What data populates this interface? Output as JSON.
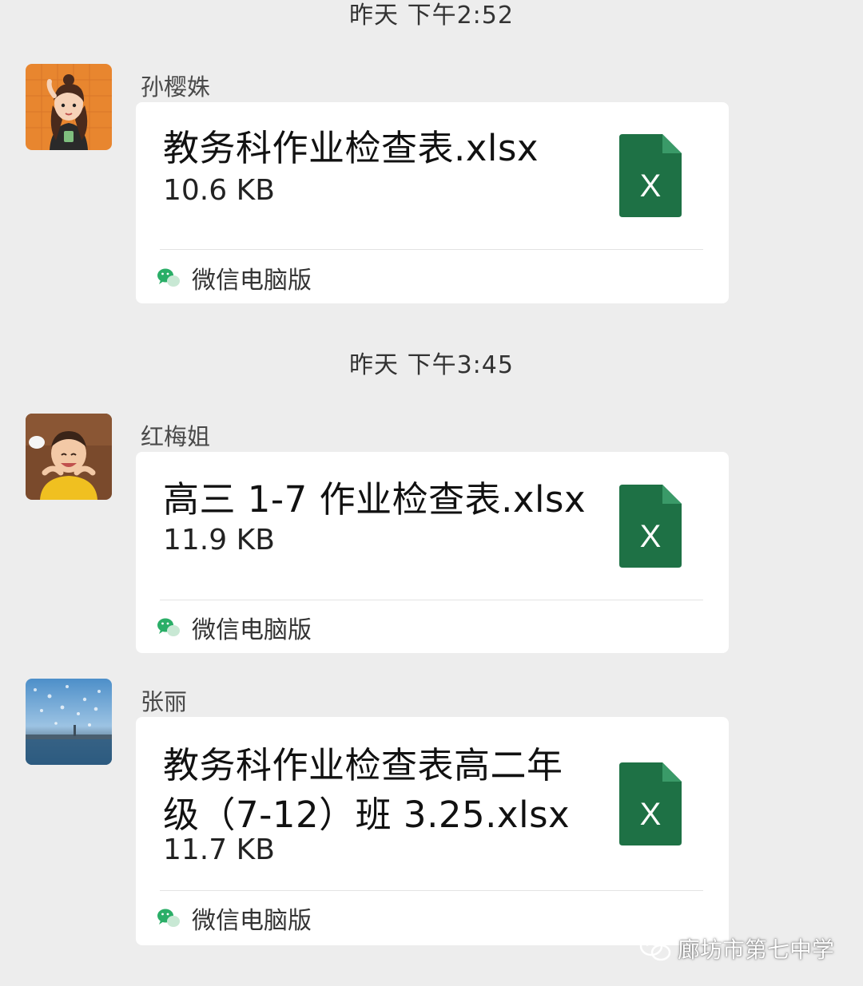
{
  "timestamps": [
    "昨天 下午2:52",
    "昨天 下午3:45"
  ],
  "messages": [
    {
      "sender": "孙樱姝",
      "file_name": "教务科作业检查表.xlsx",
      "file_size": "10.6 KB",
      "file_icon": "excel-file-icon",
      "file_icon_letter": "X",
      "source_icon": "wechat-icon",
      "source_label": "微信电脑版"
    },
    {
      "sender": "红梅姐",
      "file_name": "高三 1-7 作业检查表.xlsx",
      "file_size": "11.9 KB",
      "file_icon": "excel-file-icon",
      "file_icon_letter": "X",
      "source_icon": "wechat-icon",
      "source_label": "微信电脑版"
    },
    {
      "sender": "张丽",
      "file_name": "教务科作业检查表高二年级（7-12）班 3.25.xlsx",
      "file_size": "11.7 KB",
      "file_icon": "excel-file-icon",
      "file_icon_letter": "X",
      "source_icon": "wechat-icon",
      "source_label": "微信电脑版"
    }
  ],
  "watermark": {
    "icon": "wechat-icon",
    "text": "廊坊市第七中学"
  },
  "colors": {
    "background": "#ededed",
    "card": "#ffffff",
    "excel_green": "#1e7145",
    "wechat_green": "#2aae67"
  }
}
